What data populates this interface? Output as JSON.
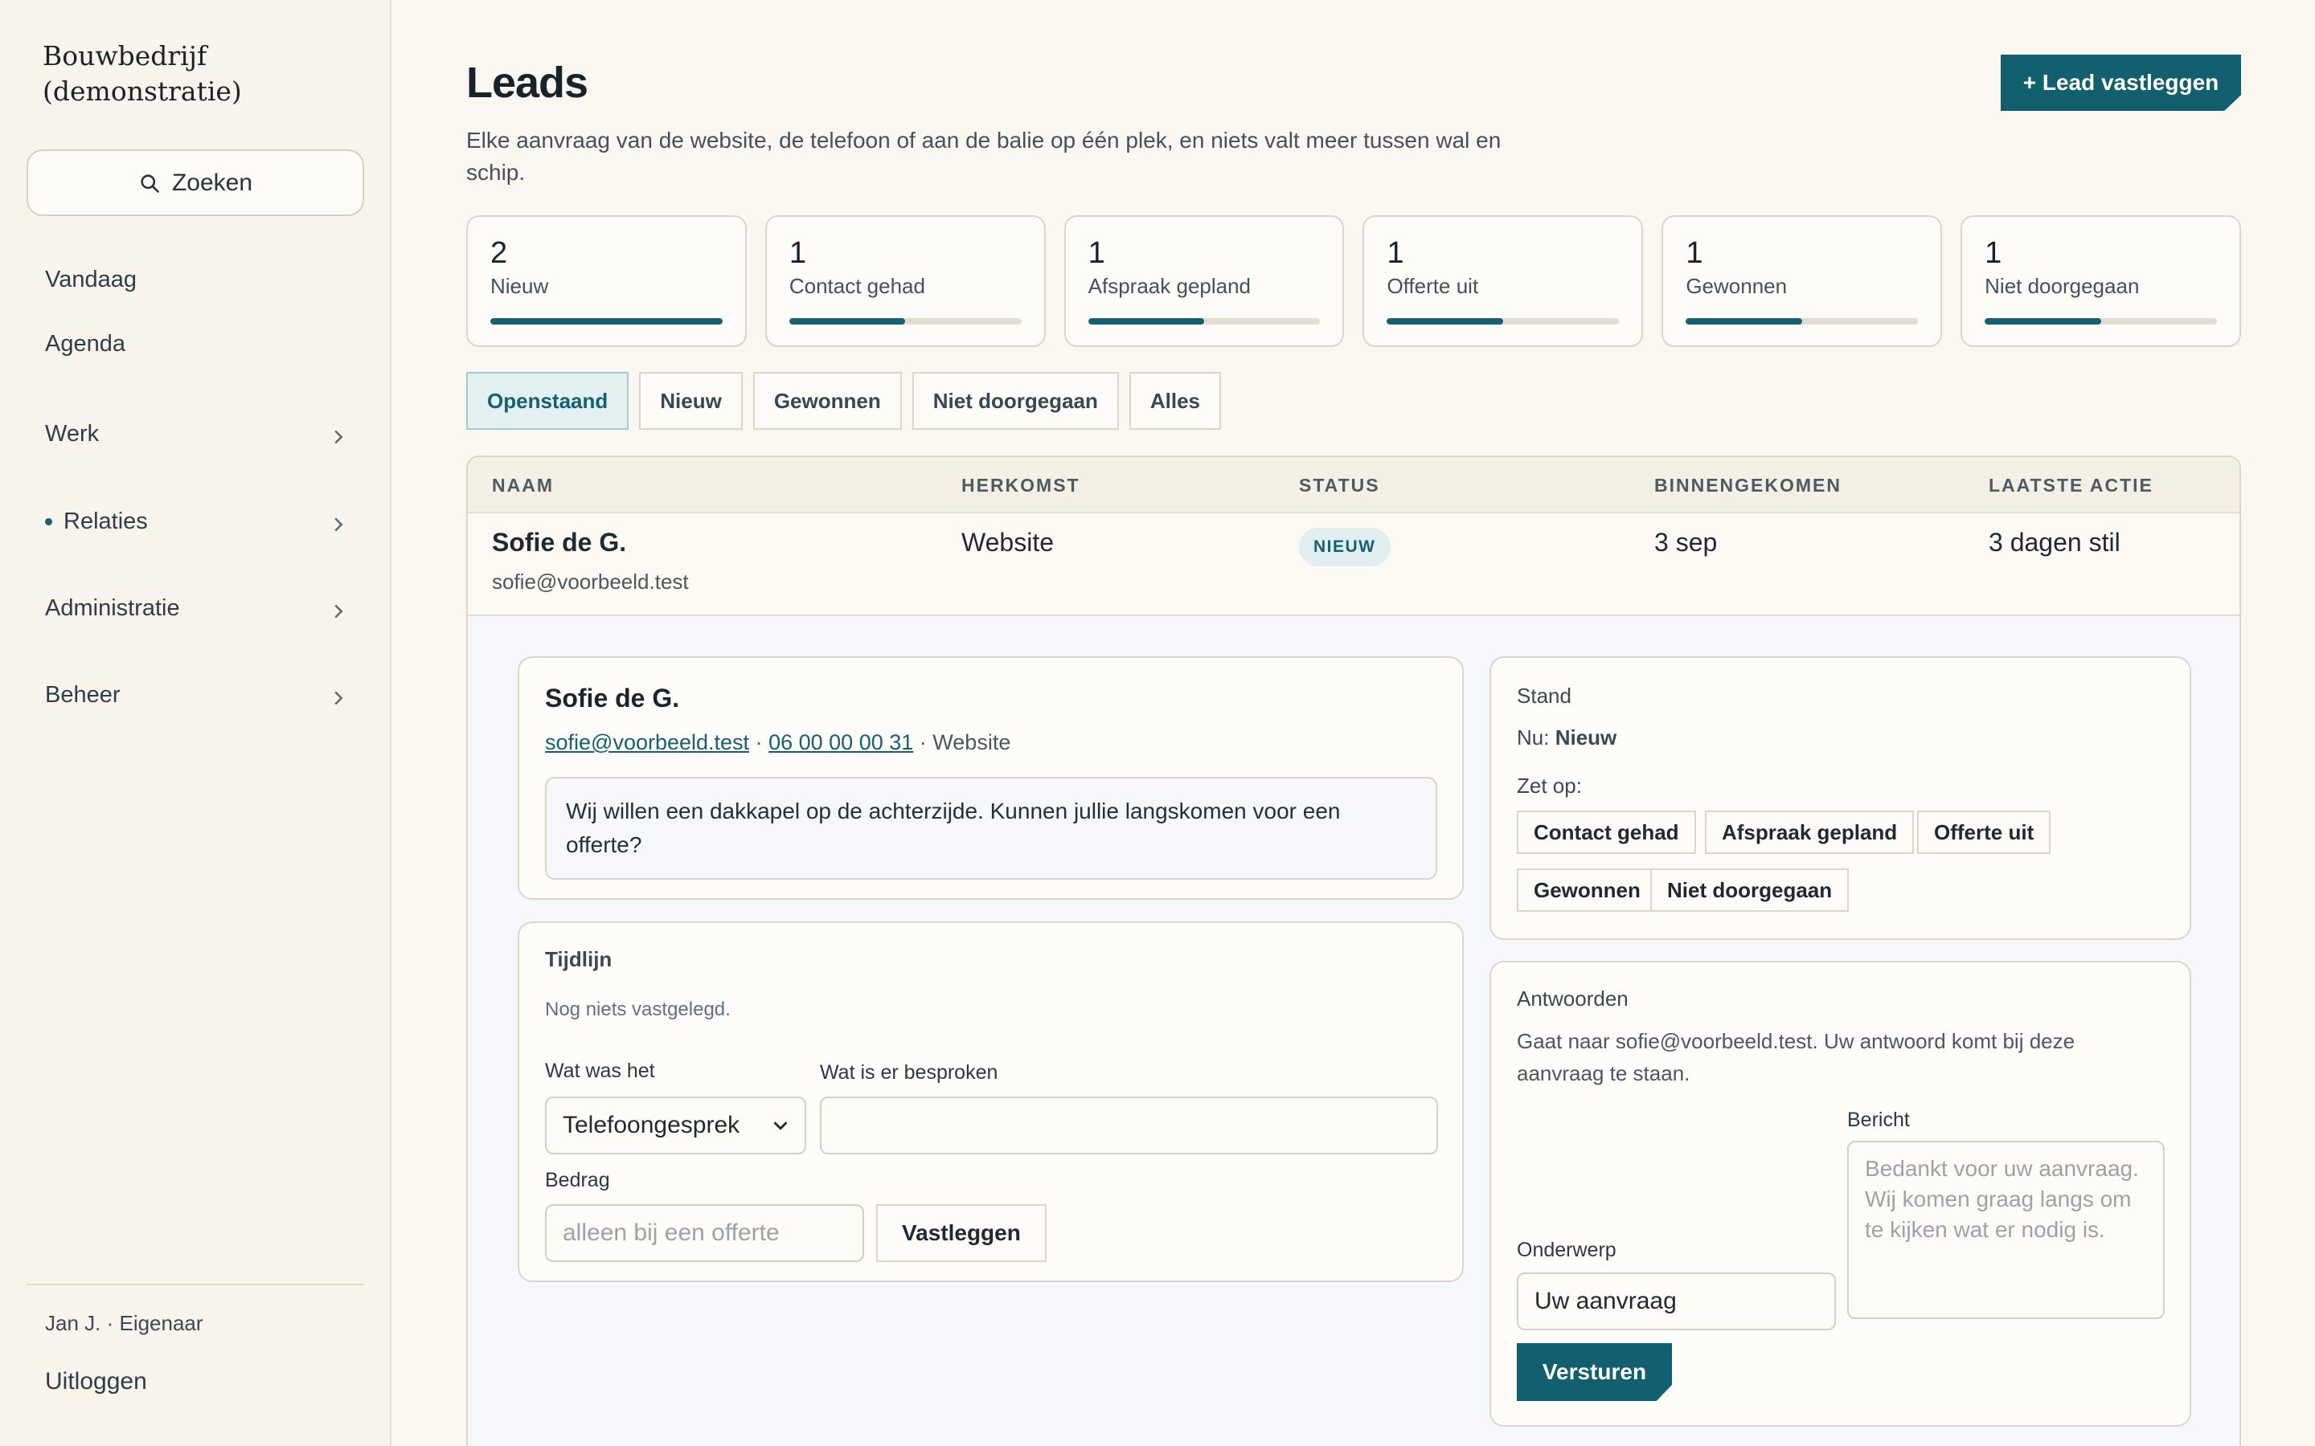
{
  "sidebar": {
    "brand_line1": "Bouwbedrijf",
    "brand_line2": "(demonstratie)",
    "search_label": "Zoeken",
    "items": [
      {
        "label": "Vandaag"
      },
      {
        "label": "Agenda"
      },
      {
        "label": "Werk"
      },
      {
        "label": "Relaties"
      },
      {
        "label": "Administratie"
      },
      {
        "label": "Beheer"
      }
    ],
    "user": "Jan J. · Eigenaar",
    "logout": "Uitloggen"
  },
  "header": {
    "title": "Leads",
    "subtitle": "Elke aanvraag van de website, de telefoon of aan de balie op één plek, en niets valt meer tussen wal en schip.",
    "primary_button": "+ Lead vastleggen"
  },
  "stats": [
    {
      "count": "2",
      "label": "Nieuw",
      "fraction": 1.0
    },
    {
      "count": "1",
      "label": "Contact gehad",
      "fraction": 0.5
    },
    {
      "count": "1",
      "label": "Afspraak gepland",
      "fraction": 0.5
    },
    {
      "count": "1",
      "label": "Offerte uit",
      "fraction": 0.5
    },
    {
      "count": "1",
      "label": "Gewonnen",
      "fraction": 0.5
    },
    {
      "count": "1",
      "label": "Niet doorgegaan",
      "fraction": 0.5
    }
  ],
  "filters": [
    "Openstaand",
    "Nieuw",
    "Gewonnen",
    "Niet doorgegaan",
    "Alles"
  ],
  "table": {
    "headers": [
      "NAAM",
      "HERKOMST",
      "STATUS",
      "BINNENGEKOMEN",
      "LAATSTE ACTIE"
    ],
    "row": {
      "name": "Sofie de G.",
      "email": "sofie@voorbeeld.test",
      "source": "Website",
      "status": "NIEUW",
      "received": "3 sep",
      "last_action": "3 dagen stil"
    }
  },
  "detail": {
    "name": "Sofie de G.",
    "email": "sofie@voorbeeld.test",
    "phone": "06 00 00 00 31",
    "source": "Website",
    "separator": "·",
    "message": "Wij willen een dakkapel op de achterzijde. Kunnen jullie langskomen voor een offerte?",
    "timeline": {
      "title": "Tijdlijn",
      "empty": "Nog niets vastgelegd.",
      "type_label": "Wat was het",
      "type_value": "Telefoongesprek",
      "discussed_label": "Wat is er besproken",
      "amount_label": "Bedrag",
      "amount_placeholder": "alleen bij een offerte",
      "save_button": "Vastleggen"
    },
    "stand": {
      "title": "Stand",
      "current_prefix": "Nu:",
      "current_value": "Nieuw",
      "set_label": "Zet op:",
      "options": [
        "Contact gehad",
        "Afspraak gepland",
        "Offerte uit",
        "Gewonnen",
        "Niet doorgegaan"
      ]
    },
    "reply": {
      "title": "Antwoorden",
      "description": "Gaat naar sofie@voorbeeld.test. Uw antwoord komt bij deze aanvraag te staan.",
      "message_label": "Bericht",
      "message_placeholder": "Bedankt voor uw aanvraag. Wij komen graag langs om te kijken wat er nodig is.",
      "subject_label": "Onderwerp",
      "subject_value": "Uw aanvraag",
      "send_button": "Versturen"
    }
  }
}
